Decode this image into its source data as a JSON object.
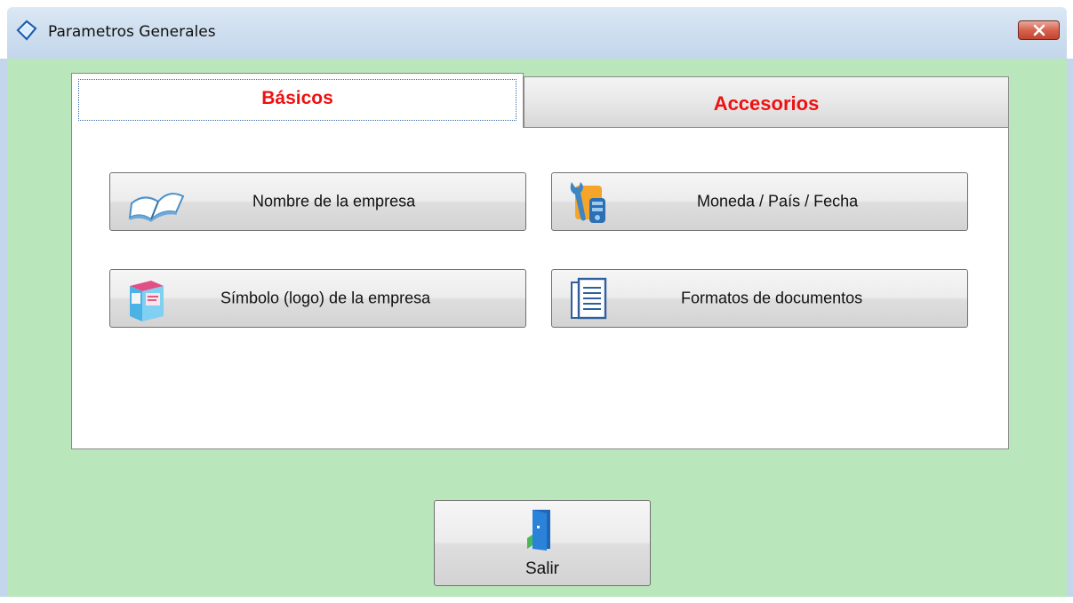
{
  "window": {
    "title": "Parametros Generales"
  },
  "tabs": {
    "basicos": "Básicos",
    "accesorios": "Accesorios"
  },
  "buttons": {
    "nombre": "Nombre de la empresa",
    "moneda": "Moneda / País / Fecha",
    "simbolo": "Símbolo (logo) de la empresa",
    "formatos": "Formatos de documentos",
    "salir": "Salir"
  },
  "colors": {
    "background": "#b9e6bb",
    "tab_text": "#ee1111",
    "titlebar": "#cfdfef",
    "close": "#c4432f"
  },
  "icons": {
    "title": "diamond-icon",
    "nombre": "open-book-icon",
    "moneda": "tools-icon",
    "simbolo": "logo-box-icon",
    "formatos": "document-icon",
    "salir": "exit-door-icon"
  }
}
